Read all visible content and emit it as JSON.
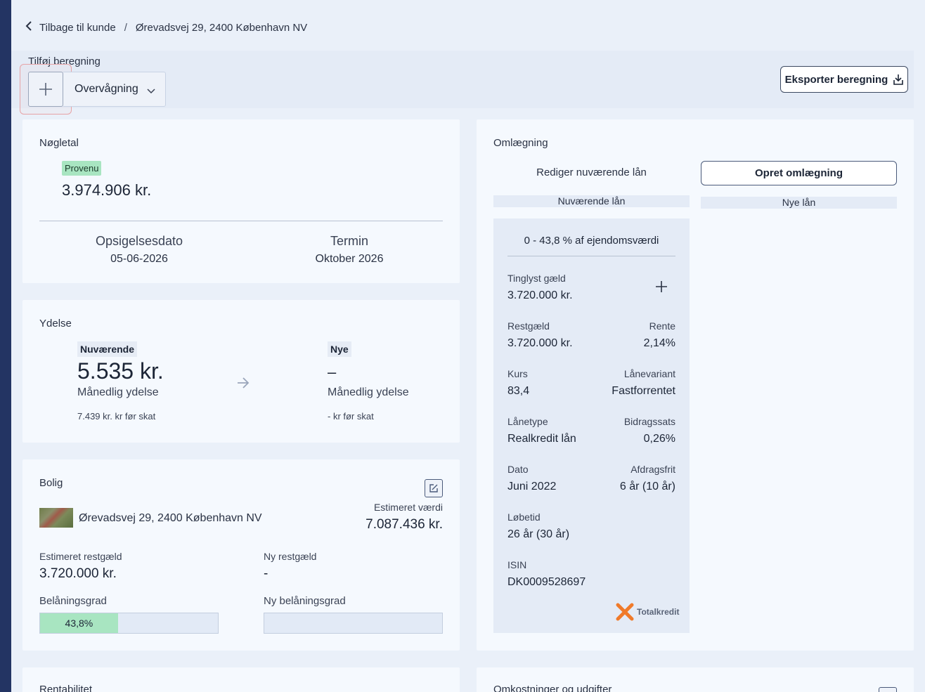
{
  "breadcrumb": {
    "back_label": "Tilbage til kunde",
    "separator": "/",
    "current": "Ørevadsvej 29, 2400 København NV"
  },
  "toolbar": {
    "label": "Tilføj beregning",
    "select_value": "Overvågning",
    "export_label": "Eksporter beregning"
  },
  "noegletal": {
    "title": "Nøgletal",
    "badge": "Provenu",
    "value": "3.974.906 kr.",
    "stats": [
      {
        "label": "Opsigelsesdato",
        "value": "05-06-2026"
      },
      {
        "label": "Termin",
        "value": "Oktober 2026"
      }
    ]
  },
  "ydelse": {
    "title": "Ydelse",
    "current": {
      "badge": "Nuværende",
      "value": "5.535 kr.",
      "label": "Månedlig ydelse",
      "note": "7.439 kr. kr før skat"
    },
    "new": {
      "badge": "Nye",
      "value": "–",
      "label": "Månedlig ydelse",
      "note": "- kr før skat"
    }
  },
  "bolig": {
    "title": "Bolig",
    "address": "Ørevadsvej 29, 2400 København NV",
    "estimated_value_label": "Estimeret værdi",
    "estimated_value": "7.087.436 kr.",
    "est_restgaeld_label": "Estimeret restgæld",
    "est_restgaeld": "3.720.000 kr.",
    "ny_restgaeld_label": "Ny restgæld",
    "ny_restgaeld": "-",
    "belaaningsgrad_label": "Belåningsgrad",
    "belaaningsgrad": "43,8%",
    "belaaningsgrad_fraction": 0.438,
    "ny_belaaningsgrad_label": "Ny belåningsgrad"
  },
  "omlaegning": {
    "title": "Omlægning",
    "edit_label": "Rediger nuværende lån",
    "create_label": "Opret omlægning",
    "col_current": "Nuværende lån",
    "col_new": "Nye lån",
    "loan": {
      "range": "0 - 43,8 % af ejendomsværdi",
      "tinglyst_label": "Tinglyst gæld",
      "tinglyst": "3.720.000 kr.",
      "restgaeld_label": "Restgæld",
      "restgaeld": "3.720.000 kr.",
      "rente_label": "Rente",
      "rente": "2,14%",
      "kurs_label": "Kurs",
      "kurs": "83,4",
      "variant_label": "Lånevariant",
      "variant": "Fastforrentet",
      "type_label": "Lånetype",
      "type": "Realkredit lån",
      "bidrag_label": "Bidragssats",
      "bidrag": "0,26%",
      "dato_label": "Dato",
      "dato": "Juni 2022",
      "afdragsfrit_label": "Afdragsfrit",
      "afdragsfrit": "6 år (10 år)",
      "loebetid_label": "Løbetid",
      "loebetid": "26 år (30 år)",
      "isin_label": "ISIN",
      "isin": "DK0009528697",
      "lender": "Totalkredit"
    }
  },
  "bottom": {
    "left_title": "Rentabilitet",
    "right_title": "Omkostninger og udgifter"
  },
  "colors": {
    "rail": "#233463",
    "accent_green": "#a8e5c1",
    "logo_orange": "#f07a2a"
  }
}
